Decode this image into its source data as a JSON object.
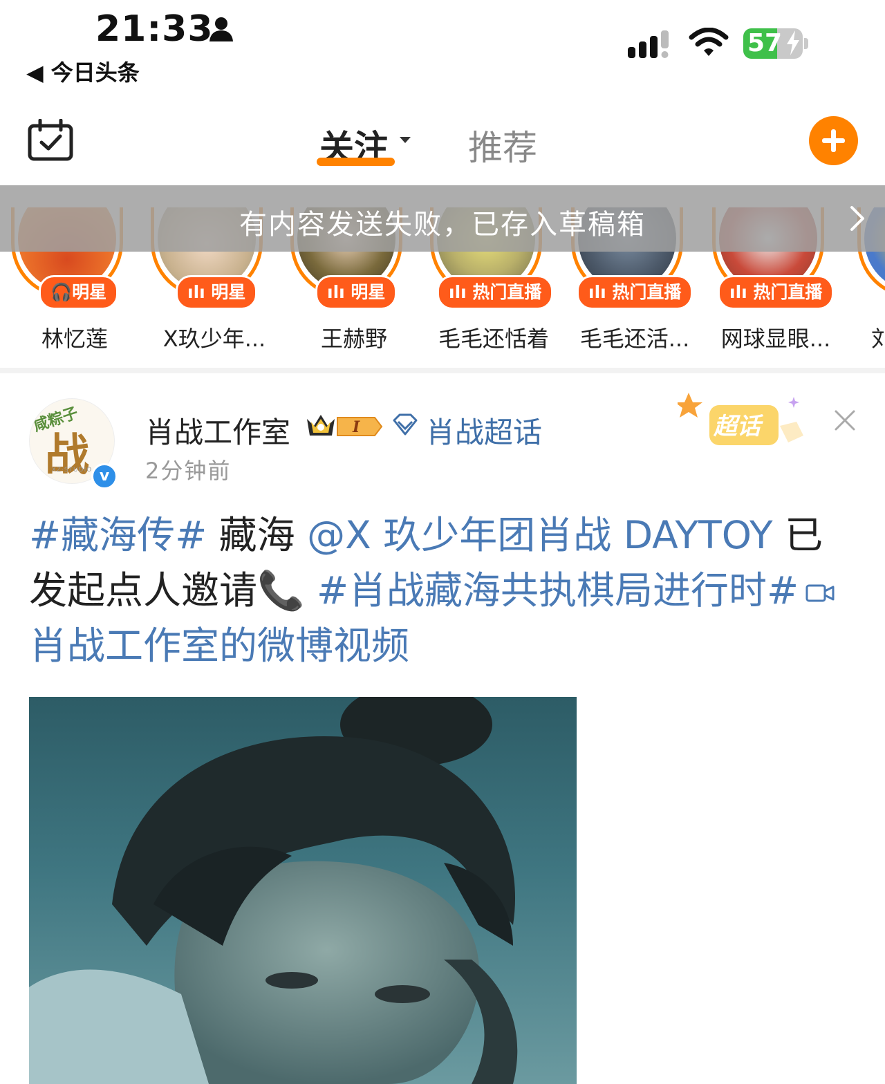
{
  "status_bar": {
    "time": "21:33",
    "back_app": "◀ 今日头条",
    "battery_level": 57,
    "battery_text": "57"
  },
  "nav": {
    "tab_follow": "关注",
    "tab_recommend": "推荐"
  },
  "banner": {
    "text": "有内容发送失败，已存入草稿箱"
  },
  "stories": [
    {
      "name": "林忆莲",
      "badge": "明星"
    },
    {
      "name": "X玖少年...",
      "badge": "明星"
    },
    {
      "name": "王赫野",
      "badge": "明星"
    },
    {
      "name": "毛毛还恬着",
      "badge": "热门直播"
    },
    {
      "name": "毛毛还活...",
      "badge": "热门直播"
    },
    {
      "name": "网球显眼...",
      "badge": "热门直播"
    },
    {
      "name": "刘",
      "badge": ""
    }
  ],
  "post": {
    "author": "肖战工作室",
    "avatar_top_text": "咸粽子",
    "avatar_char": "战",
    "avatar_sub": "XZ·STUDIO",
    "crown_badge_text": "I",
    "topic": "肖战超话",
    "time": "2分钟前",
    "supertopic_badge": "超话",
    "text": {
      "hashtag1": "#藏海传#",
      "plain1": " 藏海 ",
      "mention": "@X 玖少年团肖战 DAYTOY",
      "plain2": " 已发起点人邀请📞 ",
      "hashtag2": "#肖战藏海共执棋局进行时#",
      "video_link": "肖战工作室的微博视频"
    }
  },
  "colors": {
    "accent": "#ff8200",
    "link": "#4a7ab5",
    "badge": "#ff5b1a",
    "battery": "#3fc04a"
  }
}
